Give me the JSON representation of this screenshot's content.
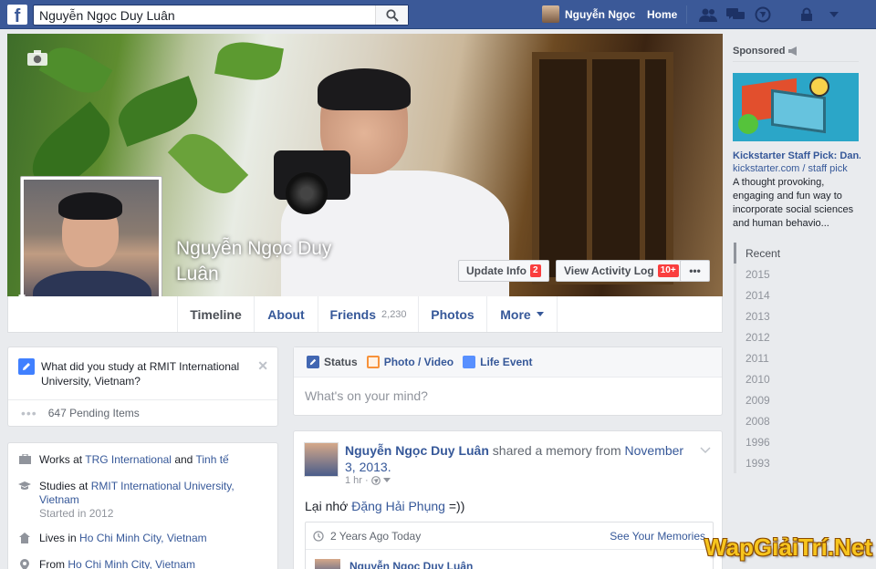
{
  "topbar": {
    "logo": "f",
    "search_value": "Nguyễn Ngọc Duy Luân",
    "user_name": "Nguyễn Ngọc",
    "home_label": "Home"
  },
  "cover": {
    "profile_name": "Nguyễn Ngọc Duy Luân",
    "update_info_label": "Update Info",
    "update_info_badge": "2",
    "activity_log_label": "View Activity Log",
    "activity_log_badge": "10+",
    "more_label": "•••"
  },
  "tabs": [
    {
      "label": "Timeline"
    },
    {
      "label": "About"
    },
    {
      "label": "Friends",
      "count": "2,230"
    },
    {
      "label": "Photos"
    },
    {
      "label": "More"
    }
  ],
  "study_prompt": {
    "question": "What did you study at RMIT International University, Vietnam?",
    "pending": "647 Pending Items"
  },
  "intro": {
    "works_prefix": "Works at",
    "works_company1": "TRG International",
    "works_and": "and",
    "works_company2": "Tinh tế",
    "studies_prefix": "Studies at",
    "studies_school": "RMIT International University, Vietnam",
    "studies_started": "Started in 2012",
    "lives_prefix": "Lives in",
    "lives_city": "Ho Chi Minh City, Vietnam",
    "from_prefix": "From",
    "from_city": "Ho Chi Minh City, Vietnam"
  },
  "composer": {
    "status_label": "Status",
    "photo_label": "Photo / Video",
    "life_label": "Life Event",
    "placeholder": "What's on your mind?"
  },
  "post": {
    "author": "Nguyễn Ngọc Duy Luân",
    "action": "shared a memory from",
    "date": "November 3, 2013.",
    "time": "1 hr",
    "body_prefix": "Lại nhớ",
    "body_tag": "Đặng Hải Phụng",
    "body_suffix": "=))",
    "memory_label": "2 Years Ago Today",
    "memory_link": "See Your Memories",
    "memory_author": "Nguyễn Ngọc Duy Luân"
  },
  "sponsored": {
    "title": "Sponsored",
    "ad_title": "Kickstarter Staff Pick: Dan...",
    "ad_domain": "kickstarter.com / staff pick",
    "ad_desc": "A thought provoking, engaging and fun way to incorporate social sciences and human behavio..."
  },
  "years": [
    "Recent",
    "2015",
    "2014",
    "2013",
    "2012",
    "2011",
    "2010",
    "2009",
    "2008",
    "1996",
    "1993"
  ],
  "watermark": "WapGiảiTrí.Net",
  "colors": {
    "brand": "#3b5998",
    "link": "#365899",
    "badge": "#fa3e3e"
  }
}
